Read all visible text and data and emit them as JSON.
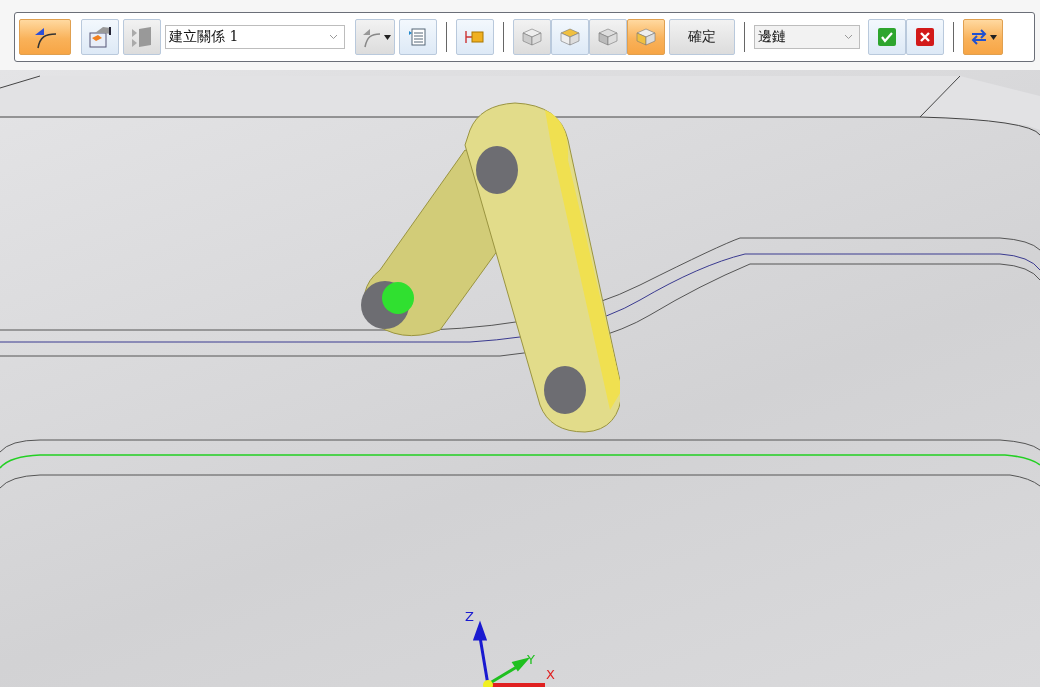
{
  "toolbar": {
    "relation_tool_selected": true,
    "relation_name": "建立關係 1",
    "face_buttons": [
      {
        "selected": false
      },
      {
        "selected": false
      },
      {
        "selected": false
      },
      {
        "selected": true
      }
    ],
    "accept_label": "確定",
    "selection_mode": "邊鏈",
    "swap_selected": true
  },
  "axes": [
    {
      "label": "Z",
      "color": "#1a1ad0"
    },
    {
      "label": "Y",
      "color": "#20c020"
    },
    {
      "label": "X",
      "color": "#e02020"
    }
  ]
}
